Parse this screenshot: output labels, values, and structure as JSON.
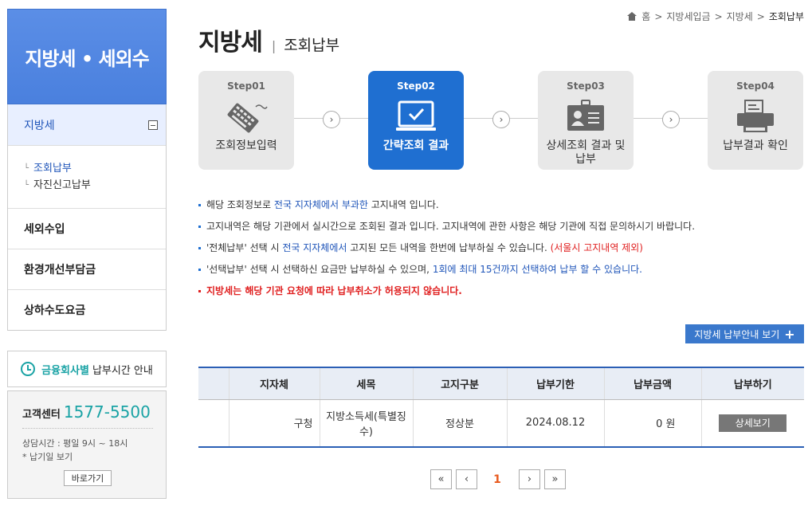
{
  "sidebar": {
    "title": "지방세 • 세외수",
    "active_item": "지방세",
    "sub_items": [
      "조회납부",
      "자진신고납부"
    ],
    "items": [
      "세외수입",
      "환경개선부담금",
      "상하수도요금"
    ],
    "finance_hl": "금융회사별",
    "finance_rest": "납부시간 안내",
    "cs_label": "고객센터",
    "cs_number": "1577-5500",
    "cs_hours": "상담시간 : 평일 9시 ~ 18시",
    "cs_note": "* 납기일 보기",
    "cs_button": "바로가기"
  },
  "breadcrumb": {
    "home": "홈",
    "items": [
      "지방세입금",
      "지방세"
    ],
    "current": "조회납부"
  },
  "header": {
    "title": "지방세",
    "separator": "|",
    "subtitle": "조회납부"
  },
  "steps": [
    {
      "num": "Step01",
      "label": "조회정보입력",
      "icon": "keyboard-icon"
    },
    {
      "num": "Step02",
      "label": "간략조회 결과",
      "icon": "monitor-check-icon"
    },
    {
      "num": "Step03",
      "label": "상세조회 결과 및 납부",
      "icon": "id-card-icon"
    },
    {
      "num": "Step04",
      "label": "납부결과 확인",
      "icon": "printer-icon"
    }
  ],
  "notices": {
    "n1_a": "해당 조회정보로 ",
    "n1_b": "전국 지자체에서 부과한",
    "n1_c": " 고지내역 입니다.",
    "n2": "고지내역은 해당 기관에서 실시간으로 조회된 결과 입니다. 고지내역에 관한 사항은 해당 기관에 직접 문의하시기 바랍니다.",
    "n3_a": "'전체납부' 선택 시 ",
    "n3_b": "전국 지자체에서",
    "n3_c": " 고지된 모든 내역을 한번에 납부하실 수 있습니다. ",
    "n3_d": "(서울시 고지내역 제외)",
    "n4_a": "'선택납부' 선택 시 선택하신 요금만 납부하실 수 있으며, ",
    "n4_b": "1회에 최대 15건까지 선택하여 납부 할 수 있습니다.",
    "n5": "지방세는 해당 기관 요청에 따라 납부취소가 허용되지 않습니다."
  },
  "guide_button": "지방세 납부안내 보기",
  "table": {
    "headers": [
      "",
      "지자체",
      "세목",
      "고지구분",
      "납부기한",
      "납부금액",
      "납부하기"
    ],
    "row": {
      "region": "구청",
      "tax": "지방소득세(특별징수)",
      "type": "정상분",
      "due": "2024.08.12",
      "amount": "0 원",
      "action": "상세보기"
    }
  },
  "pagination": {
    "first": "«",
    "prev": "‹",
    "current": "1",
    "next": "›",
    "last": "»"
  }
}
